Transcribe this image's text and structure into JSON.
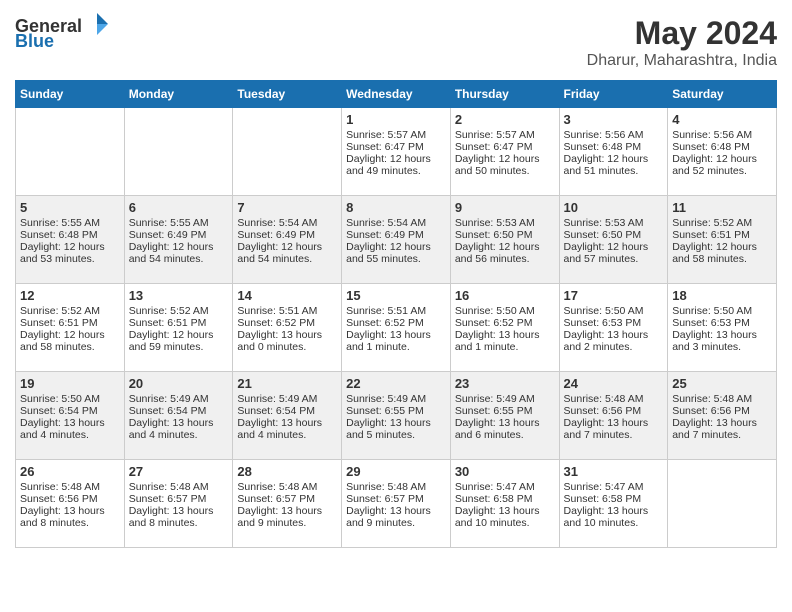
{
  "header": {
    "logo_general": "General",
    "logo_blue": "Blue",
    "month_year": "May 2024",
    "location": "Dharur, Maharashtra, India"
  },
  "days_of_week": [
    "Sunday",
    "Monday",
    "Tuesday",
    "Wednesday",
    "Thursday",
    "Friday",
    "Saturday"
  ],
  "weeks": [
    [
      {
        "day": "",
        "info": ""
      },
      {
        "day": "",
        "info": ""
      },
      {
        "day": "",
        "info": ""
      },
      {
        "day": "1",
        "sunrise": "5:57 AM",
        "sunset": "6:47 PM",
        "daylight": "12 hours and 49 minutes."
      },
      {
        "day": "2",
        "sunrise": "5:57 AM",
        "sunset": "6:47 PM",
        "daylight": "12 hours and 50 minutes."
      },
      {
        "day": "3",
        "sunrise": "5:56 AM",
        "sunset": "6:48 PM",
        "daylight": "12 hours and 51 minutes."
      },
      {
        "day": "4",
        "sunrise": "5:56 AM",
        "sunset": "6:48 PM",
        "daylight": "12 hours and 52 minutes."
      }
    ],
    [
      {
        "day": "5",
        "sunrise": "5:55 AM",
        "sunset": "6:48 PM",
        "daylight": "12 hours and 53 minutes."
      },
      {
        "day": "6",
        "sunrise": "5:55 AM",
        "sunset": "6:49 PM",
        "daylight": "12 hours and 54 minutes."
      },
      {
        "day": "7",
        "sunrise": "5:54 AM",
        "sunset": "6:49 PM",
        "daylight": "12 hours and 54 minutes."
      },
      {
        "day": "8",
        "sunrise": "5:54 AM",
        "sunset": "6:49 PM",
        "daylight": "12 hours and 55 minutes."
      },
      {
        "day": "9",
        "sunrise": "5:53 AM",
        "sunset": "6:50 PM",
        "daylight": "12 hours and 56 minutes."
      },
      {
        "day": "10",
        "sunrise": "5:53 AM",
        "sunset": "6:50 PM",
        "daylight": "12 hours and 57 minutes."
      },
      {
        "day": "11",
        "sunrise": "5:52 AM",
        "sunset": "6:51 PM",
        "daylight": "12 hours and 58 minutes."
      }
    ],
    [
      {
        "day": "12",
        "sunrise": "5:52 AM",
        "sunset": "6:51 PM",
        "daylight": "12 hours and 58 minutes."
      },
      {
        "day": "13",
        "sunrise": "5:52 AM",
        "sunset": "6:51 PM",
        "daylight": "12 hours and 59 minutes."
      },
      {
        "day": "14",
        "sunrise": "5:51 AM",
        "sunset": "6:52 PM",
        "daylight": "13 hours and 0 minutes."
      },
      {
        "day": "15",
        "sunrise": "5:51 AM",
        "sunset": "6:52 PM",
        "daylight": "13 hours and 1 minute."
      },
      {
        "day": "16",
        "sunrise": "5:50 AM",
        "sunset": "6:52 PM",
        "daylight": "13 hours and 1 minute."
      },
      {
        "day": "17",
        "sunrise": "5:50 AM",
        "sunset": "6:53 PM",
        "daylight": "13 hours and 2 minutes."
      },
      {
        "day": "18",
        "sunrise": "5:50 AM",
        "sunset": "6:53 PM",
        "daylight": "13 hours and 3 minutes."
      }
    ],
    [
      {
        "day": "19",
        "sunrise": "5:50 AM",
        "sunset": "6:54 PM",
        "daylight": "13 hours and 4 minutes."
      },
      {
        "day": "20",
        "sunrise": "5:49 AM",
        "sunset": "6:54 PM",
        "daylight": "13 hours and 4 minutes."
      },
      {
        "day": "21",
        "sunrise": "5:49 AM",
        "sunset": "6:54 PM",
        "daylight": "13 hours and 4 minutes."
      },
      {
        "day": "22",
        "sunrise": "5:49 AM",
        "sunset": "6:55 PM",
        "daylight": "13 hours and 5 minutes."
      },
      {
        "day": "23",
        "sunrise": "5:49 AM",
        "sunset": "6:55 PM",
        "daylight": "13 hours and 6 minutes."
      },
      {
        "day": "24",
        "sunrise": "5:48 AM",
        "sunset": "6:56 PM",
        "daylight": "13 hours and 7 minutes."
      },
      {
        "day": "25",
        "sunrise": "5:48 AM",
        "sunset": "6:56 PM",
        "daylight": "13 hours and 7 minutes."
      }
    ],
    [
      {
        "day": "26",
        "sunrise": "5:48 AM",
        "sunset": "6:56 PM",
        "daylight": "13 hours and 8 minutes."
      },
      {
        "day": "27",
        "sunrise": "5:48 AM",
        "sunset": "6:57 PM",
        "daylight": "13 hours and 8 minutes."
      },
      {
        "day": "28",
        "sunrise": "5:48 AM",
        "sunset": "6:57 PM",
        "daylight": "13 hours and 9 minutes."
      },
      {
        "day": "29",
        "sunrise": "5:48 AM",
        "sunset": "6:57 PM",
        "daylight": "13 hours and 9 minutes."
      },
      {
        "day": "30",
        "sunrise": "5:47 AM",
        "sunset": "6:58 PM",
        "daylight": "13 hours and 10 minutes."
      },
      {
        "day": "31",
        "sunrise": "5:47 AM",
        "sunset": "6:58 PM",
        "daylight": "13 hours and 10 minutes."
      },
      {
        "day": "",
        "info": ""
      }
    ]
  ]
}
